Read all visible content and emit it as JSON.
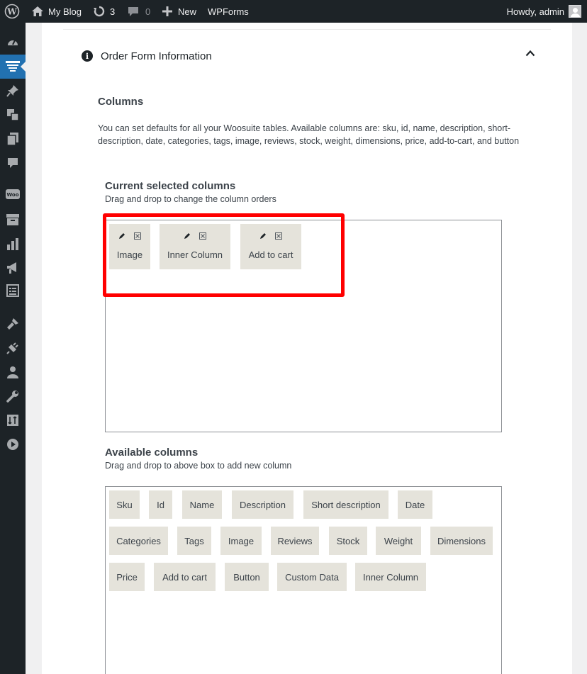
{
  "adminbar": {
    "site_name": "My Blog",
    "updates_count": "3",
    "comments_count": "0",
    "new_label": "New",
    "wpforms_label": "WPForms",
    "howdy": "Howdy, admin"
  },
  "sidebar": {
    "items": [
      {
        "icon": "dashboard-icon"
      },
      {
        "icon": "woosuite-tables-icon",
        "active": true
      },
      {
        "icon": "pin-icon"
      },
      {
        "icon": "media-icon"
      },
      {
        "icon": "pages-icon"
      },
      {
        "icon": "comments-icon"
      },
      {
        "icon": "woocommerce-icon"
      },
      {
        "icon": "products-icon"
      },
      {
        "icon": "analytics-icon"
      },
      {
        "icon": "marketing-icon"
      },
      {
        "icon": "wpforms-icon"
      },
      {
        "icon": "appearance-icon"
      },
      {
        "icon": "plugins-icon"
      },
      {
        "icon": "users-icon"
      },
      {
        "icon": "tools-icon"
      },
      {
        "icon": "settings-icon"
      },
      {
        "icon": "media-play-icon"
      }
    ]
  },
  "section": {
    "title": "Order Form Information"
  },
  "columns": {
    "heading": "Columns",
    "description": "You can set defaults for all your Woosuite tables. Available columns are: sku, id, name, description, short-description, date, categories, tags, image, reviews, stock, weight, dimensions, price, add-to-cart, and button"
  },
  "current": {
    "title": "Current selected columns",
    "help": "Drag and drop to change the column orders",
    "items": [
      "Image",
      "Inner Column",
      "Add to cart"
    ]
  },
  "available": {
    "title": "Available columns",
    "help": "Drag and drop to above box to add new column",
    "items": [
      "Sku",
      "Id",
      "Name",
      "Description",
      "Short description",
      "Date",
      "Categories",
      "Tags",
      "Image",
      "Reviews",
      "Stock",
      "Weight",
      "Dimensions",
      "Price",
      "Add to cart",
      "Button",
      "Custom Data",
      "Inner Column"
    ]
  },
  "colors": {
    "adminbar_bg": "#1d2327",
    "active_menu": "#2271b1",
    "chip_bg": "#e5e3db",
    "highlight": "#ff0000"
  }
}
